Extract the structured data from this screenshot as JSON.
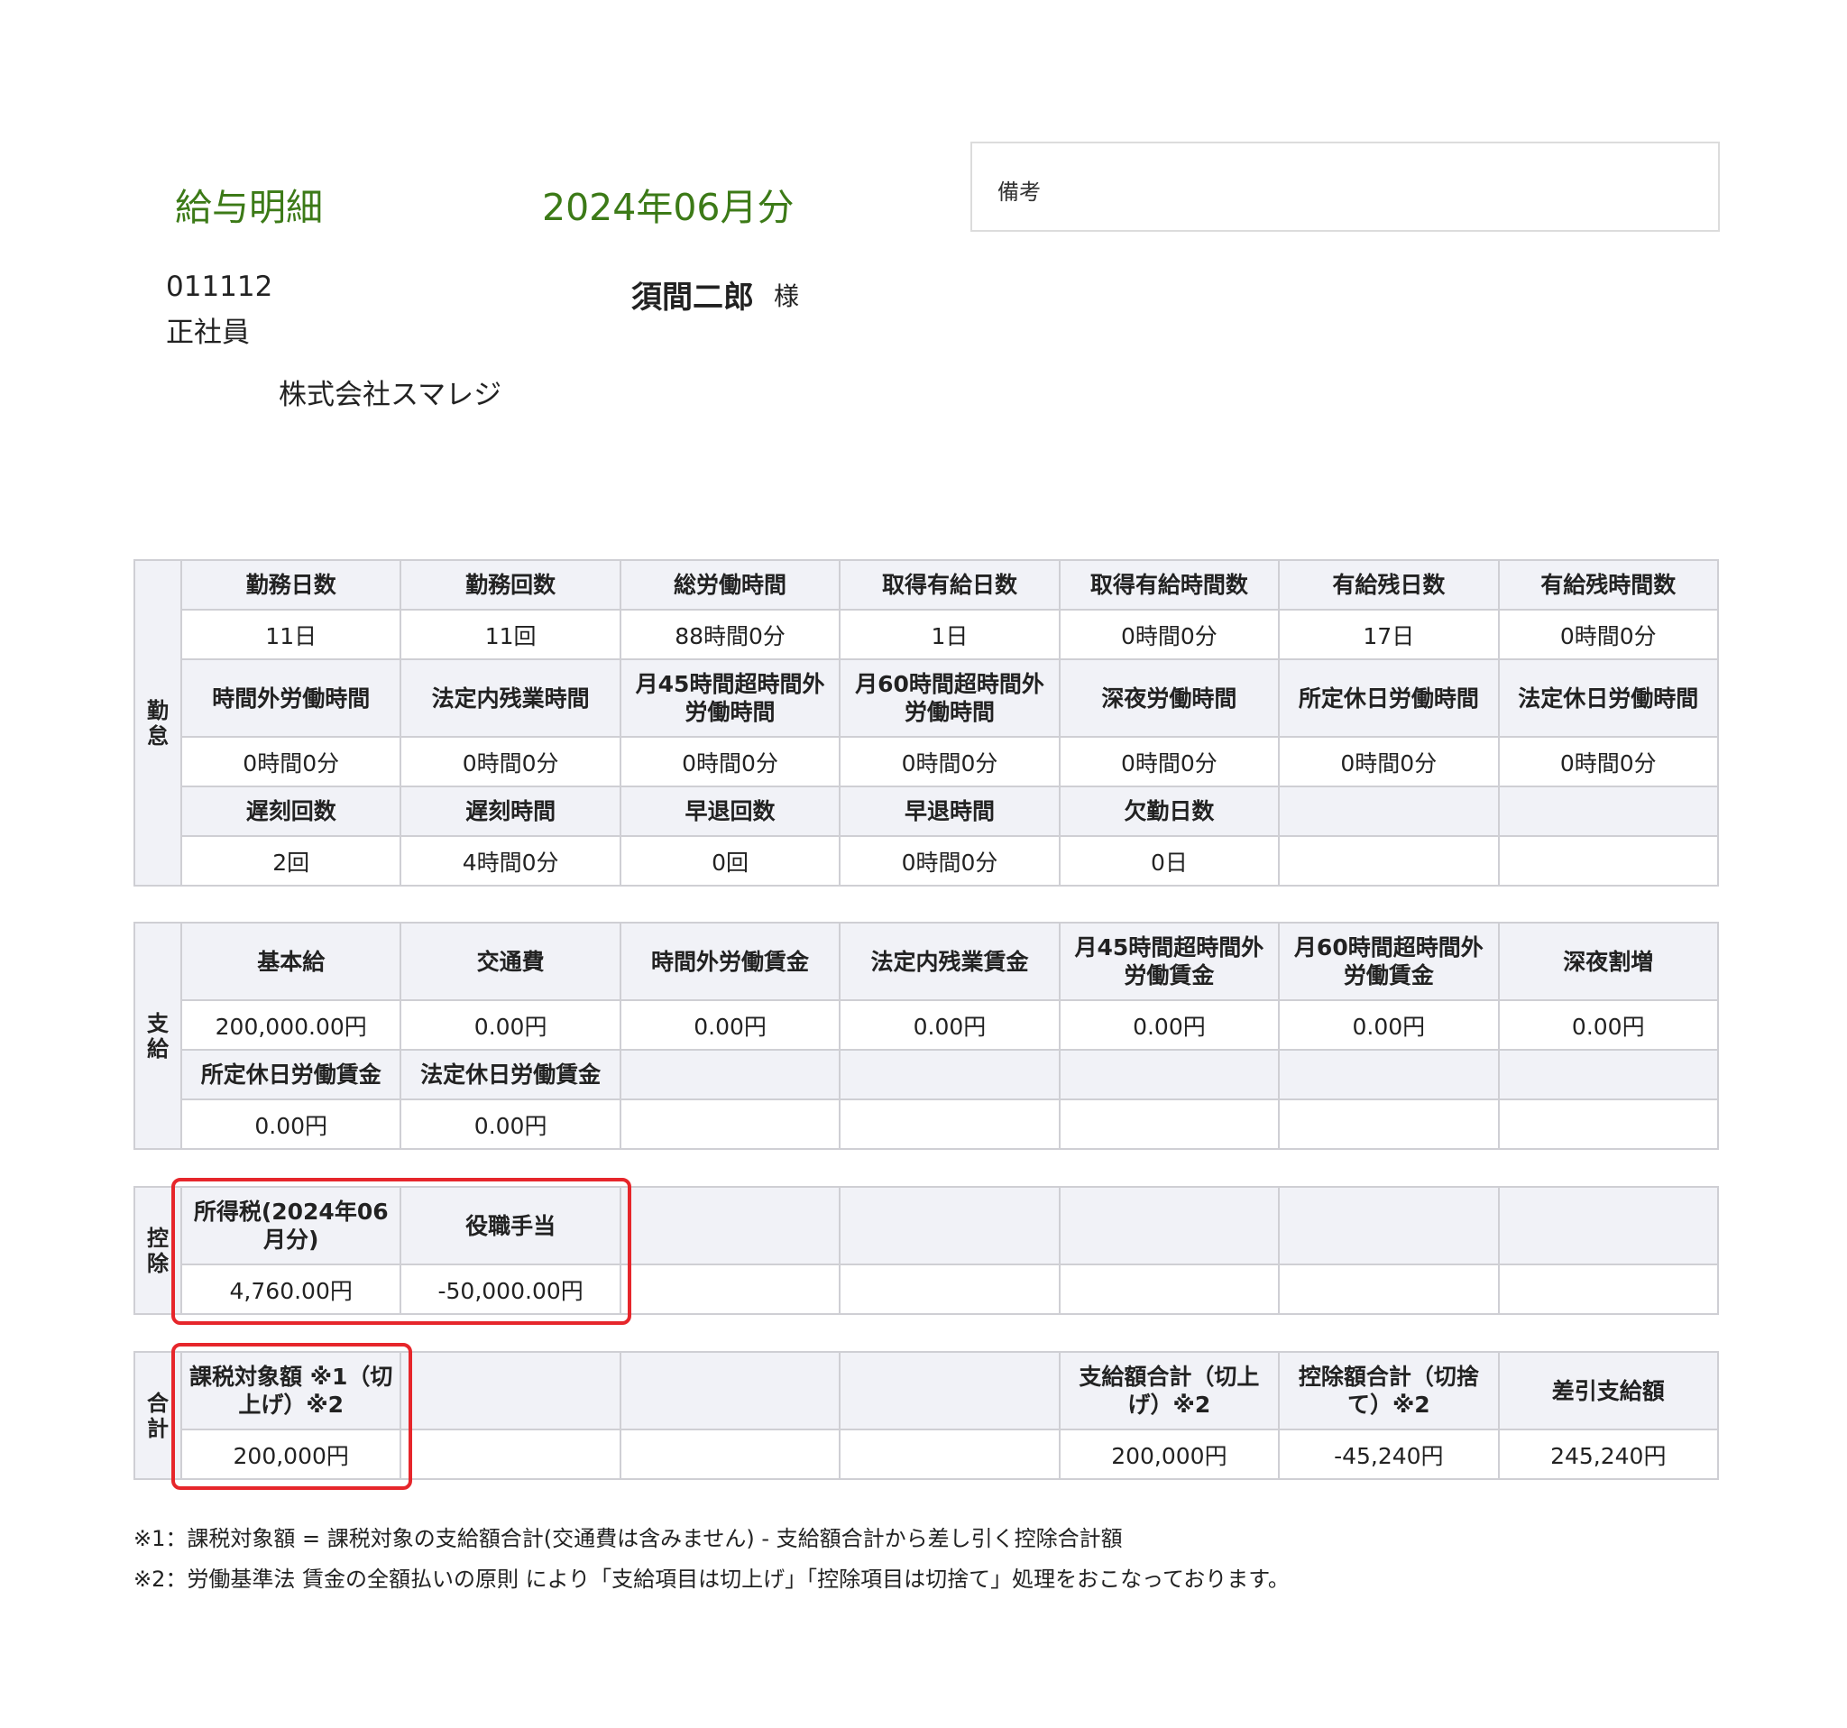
{
  "header": {
    "title": "給与明細",
    "period": "2024年06月分",
    "remarks_label": "備考"
  },
  "employee": {
    "id": "011112",
    "type": "正社員",
    "name": "須間二郎",
    "honorific": "様",
    "company": "株式会社スマレジ"
  },
  "attendance": {
    "side": [
      "勤",
      "怠"
    ],
    "rows": [
      {
        "headers": [
          "勤務日数",
          "勤務回数",
          "総労働時間",
          "取得有給日数",
          "取得有給時間数",
          "有給残日数",
          "有給残時間数"
        ],
        "values": [
          "11日",
          "11回",
          "88時間0分",
          "1日",
          "0時間0分",
          "17日",
          "0時間0分"
        ]
      },
      {
        "headers": [
          "時間外労働時間",
          "法定内残業時間",
          "月45時間超時間外労働時間",
          "月60時間超時間外労働時間",
          "深夜労働時間",
          "所定休日労働時間",
          "法定休日労働時間"
        ],
        "values": [
          "0時間0分",
          "0時間0分",
          "0時間0分",
          "0時間0分",
          "0時間0分",
          "0時間0分",
          "0時間0分"
        ]
      },
      {
        "headers": [
          "遅刻回数",
          "遅刻時間",
          "早退回数",
          "早退時間",
          "欠勤日数",
          "",
          ""
        ],
        "values": [
          "2回",
          "4時間0分",
          "0回",
          "0時間0分",
          "0日",
          "",
          ""
        ]
      }
    ]
  },
  "payments": {
    "side": [
      "支",
      "給"
    ],
    "rows": [
      {
        "headers": [
          "基本給",
          "交通費",
          "時間外労働賃金",
          "法定内残業賃金",
          "月45時間超時間外労働賃金",
          "月60時間超時間外労働賃金",
          "深夜割増"
        ],
        "values": [
          "200,000.00円",
          "0.00円",
          "0.00円",
          "0.00円",
          "0.00円",
          "0.00円",
          "0.00円"
        ]
      },
      {
        "headers": [
          "所定休日労働賃金",
          "法定休日労働賃金",
          "",
          "",
          "",
          "",
          ""
        ],
        "values": [
          "0.00円",
          "0.00円",
          "",
          "",
          "",
          "",
          ""
        ]
      }
    ]
  },
  "deductions": {
    "side": [
      "控",
      "除"
    ],
    "rows": [
      {
        "headers": [
          "所得税(2024年06月分)",
          "役職手当",
          "",
          "",
          "",
          "",
          ""
        ],
        "values": [
          "4,760.00円",
          "-50,000.00円",
          "",
          "",
          "",
          "",
          ""
        ]
      }
    ]
  },
  "totals": {
    "side": [
      "合",
      "計"
    ],
    "rows": [
      {
        "headers": [
          "課税対象額 ※1（切上げ）※2",
          "",
          "",
          "",
          "支給額合計（切上げ）※2",
          "控除額合計（切捨て）※2",
          "差引支給額"
        ],
        "values": [
          "200,000円",
          "",
          "",
          "",
          "200,000円",
          "-45,240円",
          "245,240円"
        ]
      }
    ]
  },
  "notes": [
    "※1：課税対象額 = 課税対象の支給額合計(交通費は含みません) - 支給額合計から差し引く控除合計額",
    "※2：労働基準法 賃金の全額払いの原則 により「支給項目は切上げ」「控除項目は切捨て」処理をおこなっております。"
  ],
  "colors": {
    "title_green": "#3c7a17",
    "header_bg": "#f1f2f7",
    "border": "#cfcfd4",
    "highlight_red": "#e6262b"
  }
}
